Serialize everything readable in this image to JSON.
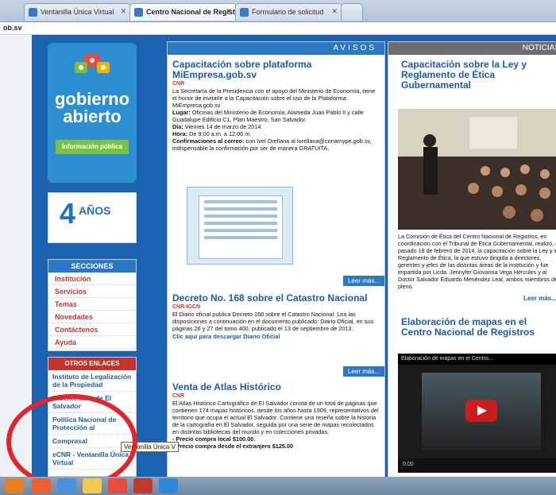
{
  "browser": {
    "tabs": [
      {
        "label": "Ventanilla Única Virtual"
      },
      {
        "label": "Centro Nacional de Regist"
      },
      {
        "label": "Formulario de solicitud"
      }
    ],
    "address": "ob.sv"
  },
  "sidebar": {
    "logo_line1": "gobierno",
    "logo_line2": "abierto",
    "logo_button": "Información pública",
    "anos_badge": "4",
    "anos_word": "AÑOS",
    "secciones_title": "SECCIONES",
    "secciones_items": [
      "Institución",
      "Servicios",
      "Temas",
      "Novedades",
      "Contáctenos",
      "Ayuda"
    ],
    "otros_title": "OTROS ENLACES",
    "otros_items": [
      "Instituto de Legalización de la Propiedad",
      "Bicentenario de El Salvador",
      "Política Nacional de Protección al",
      "Comprasal",
      "eCNR - Ventanilla Única Virtual"
    ],
    "tooltip": "Ventanilla Única V"
  },
  "avisos": {
    "header": "AVISOS",
    "articles": [
      {
        "title": "Capacitación sobre plataforma MiEmpresa.gob.sv",
        "org": "CNR",
        "body1": "La Secretaría de la Presidencia con el apoyo del Ministerio de Economía, tiene el honor de invitarle a la Capacitación sobre el uso de la Plataforma MiEmpresa.gob.sv",
        "lugar_label": "Lugar:",
        "lugar": "Oficinas del Ministerio de Economía, Alameda Juan Pablo II y calle Guadalupe Edificio C1, Plan Maestro, San Salvador.",
        "dia_label": "Día:",
        "dia": "Viernes 14 de marzo de 2014.",
        "hora_label": "Hora:",
        "hora": "De 9:00 a.m. a 12:00 m.",
        "conf_label": "Confirmaciones al correo:",
        "conf": "con Ivel Orellana al lorellana@conamype.gob.sv, indispensable la confirmación por ser de manera GRATUITA.",
        "leer": "Leer más..."
      },
      {
        "title": "Decreto No. 168 sobre el Catastro Nacional",
        "org": "CNR-IGCN",
        "body1": "El Diario oficial publica Decreto 168 sobre el Catastro Nacional. Lea las disposiciones a continuación en el documento publicado: Diario Oficial, en sus páginas 26 y 27 del tomo 400, publicado el 13 de septiembre de 2013.",
        "link": "Clic aquí para descargar Diario Oficial",
        "leer": "Leer más..."
      },
      {
        "title": "Venta de Atlas Histórico",
        "org": "CNR",
        "body1": "El Atlas Histórico Cartográfico de El Salvador consta de un total de páginas que contienen 174 mapas históricos, desde los años hasta 1909, representativos del territorio que ocupa el actual El Salvador. Contiene una reseña sobre la historia de la cartografía en El Salvador, seguida por una serie de mapas recolectados en distintas bibliotecas del mundo y en colecciones privadas.",
        "precio1": "- Precio compra local $100.00.",
        "precio2": "- Precio compra desde el extranjero $125.00"
      }
    ]
  },
  "noticias": {
    "header": "NOTICIAS",
    "item1_title": "Capacitación sobre la Ley y Reglamento de Ética Gubernamental",
    "item1_body": "La Comisión de Ética del Centro Nacional de Registros, en coordinación con el Tribunal de Ética Gubernamental, realizó, el pasado 18 de febrero de 2014, la capacitación sobre la Ley y el Reglamento de Ética, la que estuvo dirigida a directores, gerentes y jefes de las distintas áreas de la institución y fue impartida por Licda. Jennyfer Giovanna Vega Hércules y al Doctor Salvador Eduardo Menéndez Leal, ambos miembros del pleno.",
    "item1_leer": "Leer más...",
    "item2_title": "Elaboración de mapas en el Centro Nacional de Registros",
    "video_caption": "Elaboración de mapas en el Centro...",
    "video_time": "0:00"
  },
  "colors": {
    "site_blue": "#1b62b0",
    "avisos_blue": "#2c78c6",
    "link_red": "#c4362e",
    "highlight_red": "#e2242b"
  }
}
